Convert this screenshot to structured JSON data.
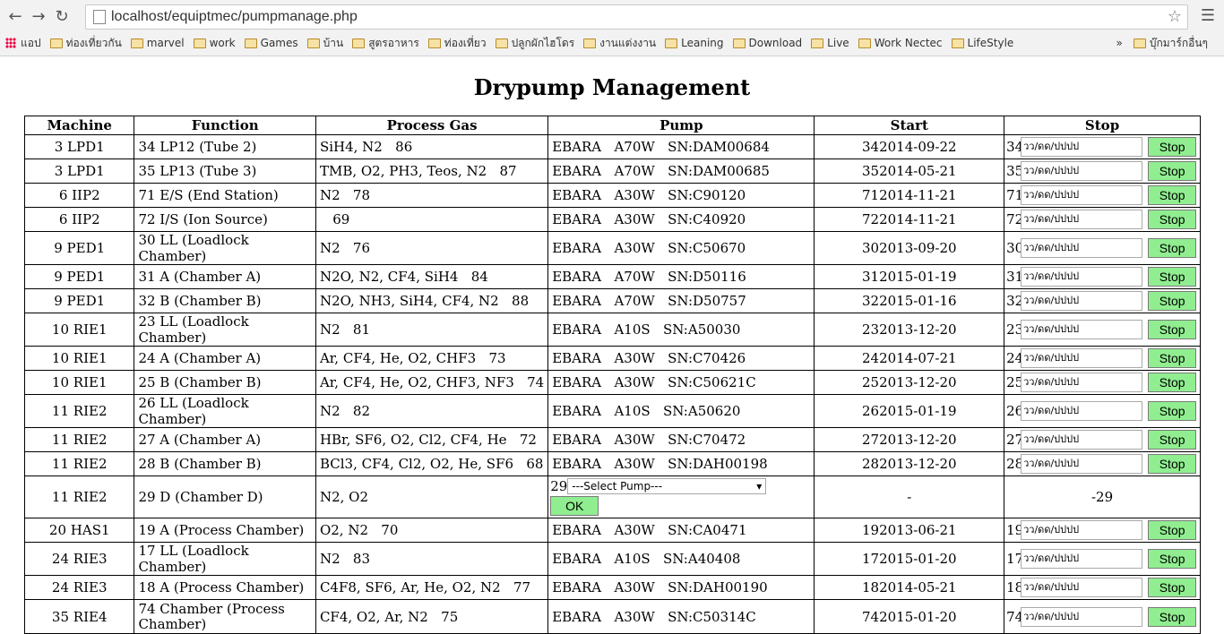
{
  "browser": {
    "url": "localhost/equiptmec/pumpmanage.php",
    "bookmarks": [
      "แอป",
      "ท่องเที่ยวกัน",
      "marvel",
      "work",
      "Games",
      "บ้าน",
      "สูตรอาหาร",
      "ท่องเที่ยว",
      "ปลูกผักไฮโดร",
      "งานแต่งงาน",
      "Leaning",
      "Download",
      "Live",
      "Work Nectec",
      "LifeStyle"
    ],
    "other_bookmarks": "บุ๊กมาร์กอื่นๆ",
    "more_chevron": "»"
  },
  "page": {
    "title": "Drypump Management",
    "date_placeholder": "วว/ดด/ปปปป",
    "stop_label": "Stop",
    "ok_label": "OK",
    "select_placeholder": "---Select Pump---"
  },
  "table": {
    "headers": [
      "Machine",
      "Function",
      "Process Gas",
      "Pump",
      "Start",
      "Stop"
    ],
    "rows": [
      {
        "machine": "3 LPD1",
        "function": "34 LP12 (Tube 2)",
        "gas": "SiH4, N2   86",
        "pump": "EBARA   A70W   SN:DAM00684",
        "start": "342014-09-22",
        "stop_id": "34"
      },
      {
        "machine": "3 LPD1",
        "function": "35 LP13 (Tube 3)",
        "gas": "TMB, O2, PH3, Teos, N2   87",
        "pump": "EBARA   A70W   SN:DAM00685",
        "start": "352014-05-21",
        "stop_id": "35"
      },
      {
        "machine": "6 IIP2",
        "function": "71 E/S (End Station)",
        "gas": "N2   78",
        "pump": "EBARA   A30W   SN:C90120",
        "start": "712014-11-21",
        "stop_id": "71"
      },
      {
        "machine": "6 IIP2",
        "function": "72 I/S (Ion Source)",
        "gas": "   69",
        "pump": "EBARA   A30W   SN:C40920",
        "start": "722014-11-21",
        "stop_id": "72"
      },
      {
        "machine": "9 PED1",
        "function": "30 LL (Loadlock Chamber)",
        "gas": "N2   76",
        "pump": "EBARA   A30W   SN:C50670",
        "start": "302013-09-20",
        "stop_id": "30"
      },
      {
        "machine": "9 PED1",
        "function": "31 A (Chamber A)",
        "gas": "N2O, N2, CF4, SiH4   84",
        "pump": "EBARA   A70W   SN:D50116",
        "start": "312015-01-19",
        "stop_id": "31"
      },
      {
        "machine": "9 PED1",
        "function": "32 B (Chamber B)",
        "gas": "N2O, NH3, SiH4, CF4, N2   88",
        "pump": "EBARA   A70W   SN:D50757",
        "start": "322015-01-16",
        "stop_id": "32"
      },
      {
        "machine": "10 RIE1",
        "function": "23 LL (Loadlock Chamber)",
        "gas": "N2   81",
        "pump": "EBARA   A10S   SN:A50030",
        "start": "232013-12-20",
        "stop_id": "23"
      },
      {
        "machine": "10 RIE1",
        "function": "24 A (Chamber A)",
        "gas": "Ar, CF4, He, O2, CHF3   73",
        "pump": "EBARA   A30W   SN:C70426",
        "start": "242014-07-21",
        "stop_id": "24"
      },
      {
        "machine": "10 RIE1",
        "function": "25 B (Chamber B)",
        "gas": "Ar, CF4, He, O2, CHF3, NF3   74",
        "pump": "EBARA   A30W   SN:C50621C",
        "start": "252013-12-20",
        "stop_id": "25"
      },
      {
        "machine": "11 RIE2",
        "function": "26 LL (Loadlock Chamber)",
        "gas": "N2   82",
        "pump": "EBARA   A10S   SN:A50620",
        "start": "262015-01-19",
        "stop_id": "26"
      },
      {
        "machine": "11 RIE2",
        "function": "27 A (Chamber A)",
        "gas": "HBr, SF6, O2, Cl2, CF4, He   72",
        "pump": "EBARA   A30W   SN:C70472",
        "start": "272013-12-20",
        "stop_id": "27"
      },
      {
        "machine": "11 RIE2",
        "function": "28 B (Chamber B)",
        "gas": "BCl3, CF4, Cl2, O2, He, SF6   68",
        "pump": "EBARA   A30W   SN:DAH00198",
        "start": "282013-12-20",
        "stop_id": "28"
      }
    ],
    "special_row": {
      "machine": "11 RIE2",
      "function": "29 D (Chamber D)",
      "gas": "N2, O2",
      "select_id": "29",
      "start": "-",
      "stop": "-29"
    },
    "rows2": [
      {
        "machine": "20 HAS1",
        "function": "19 A (Process Chamber)",
        "gas": "O2, N2   70",
        "pump": "EBARA   A30W   SN:CA0471",
        "start": "192013-06-21",
        "stop_id": "19"
      },
      {
        "machine": "24 RIE3",
        "function": "17 LL (Loadlock Chamber)",
        "gas": "N2   83",
        "pump": "EBARA   A10S   SN:A40408",
        "start": "172015-01-20",
        "stop_id": "17"
      },
      {
        "machine": "24 RIE3",
        "function": "18 A (Process Chamber)",
        "gas": "C4F8, SF6, Ar, He, O2, N2   77",
        "pump": "EBARA   A30W   SN:DAH00190",
        "start": "182014-05-21",
        "stop_id": "18"
      },
      {
        "machine": "35 RIE4",
        "function": "74 Chamber (Process Chamber)",
        "gas": "CF4, O2, Ar, N2   75",
        "pump": "EBARA   A30W   SN:C50314C",
        "start": "742015-01-20",
        "stop_id": "74"
      }
    ]
  }
}
